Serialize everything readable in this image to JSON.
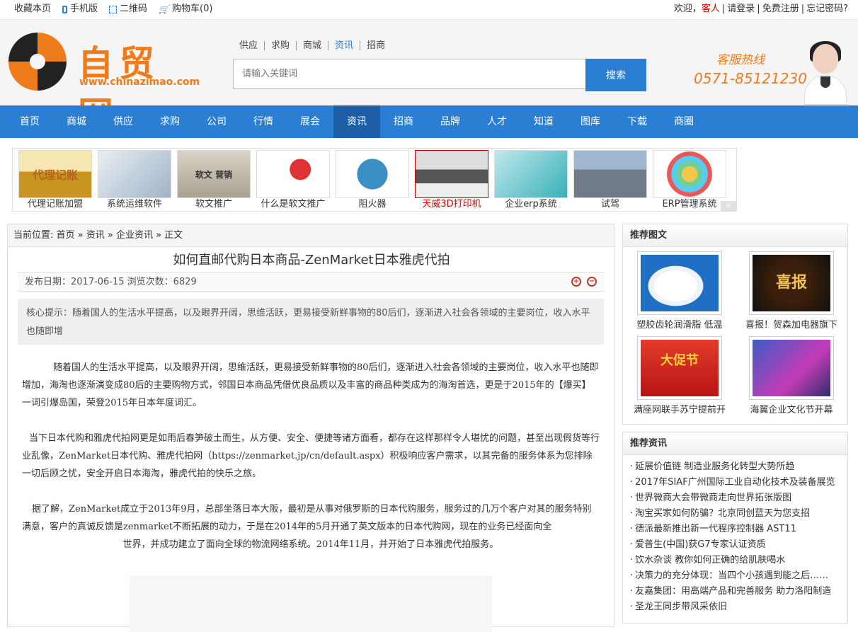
{
  "topbar": {
    "favorite": "收藏本页",
    "mobile": "手机版",
    "qrcode": "二维码",
    "cart": "购物车(0)",
    "welcome": "欢迎，",
    "guest": "客人",
    "login": "请登录",
    "register": "免费注册",
    "forgot": "忘记密码?"
  },
  "header": {
    "logo_name": "自贸网",
    "logo_url": "www.chinazimao.com",
    "search_tabs": [
      "供应",
      "求购",
      "商城",
      "资讯",
      "招商"
    ],
    "active_tab": "资讯",
    "search_placeholder": "请输入关键词",
    "search_button": "搜索",
    "hotline_label": "客服热线",
    "hotline_number": "0571-85121230"
  },
  "nav": {
    "items": [
      "首页",
      "商城",
      "供应",
      "求购",
      "公司",
      "行情",
      "展会",
      "资讯",
      "招商",
      "品牌",
      "人才",
      "知道",
      "图库",
      "下载",
      "商圈"
    ],
    "active": "资讯"
  },
  "ads": [
    {
      "caption": "代理记账加盟",
      "img_text": "代理记账"
    },
    {
      "caption": "系统运维软件",
      "img_text": ""
    },
    {
      "caption": "软文推广",
      "img_text": "软文 营销"
    },
    {
      "caption": "什么是软文推广",
      "img_text": ""
    },
    {
      "caption": "阻火器",
      "img_text": ""
    },
    {
      "caption": "天威3D打印机",
      "img_text": ""
    },
    {
      "caption": "企业erp系统",
      "img_text": ""
    },
    {
      "caption": "试驾",
      "img_text": ""
    },
    {
      "caption": "ERP管理系统",
      "img_text": ""
    }
  ],
  "ad_close": "×",
  "article": {
    "breadcrumb": "当前位置: 首页 » 资讯 » 企业资讯 » 正文",
    "title": "如何直邮代购日本商品-ZenMarket日本雅虎代拍",
    "meta": "发布日期：2017-06-15  浏览次数：6829",
    "zoom_in": "+",
    "zoom_out": "−",
    "summary": "核心提示：随着国人的生活水平提高，以及眼界开阔，思维活跃，更易接受新鲜事物的80后们，逐渐进入社会各领域的主要岗位，收入水平也随即增",
    "p1": "随着国人的生活水平提高，以及眼界开阔，思维活跃，更易接受新鲜事物的80后们，逐渐进入社会各领域的主要岗位，收入水平也随即增加，海淘也逐渐演变成80后的主要购物方式，邻国日本商品凭借优良品质以及丰富的商品种类成为的海淘首选，更是于2015年的【爆买】一词引爆岛国，荣登2015年日本年度词汇。",
    "p2": "当下日本代购和雅虎代拍网更是如雨后春笋破土而生，从方便、安全、便捷等诸方面看，都存在这样那样令人堪忧的问题，甚至出现假货等行业乱像，ZenMarket日本代购、雅虎代拍网（https://zenmarket.jp/cn/default.aspx）积极响应客户需求，以其完备的服务体系为您排除一切后顾之忧，安全开启日本海淘，雅虎代拍的快乐之旅。",
    "p3": "据了解，ZenMarket成立于2013年9月，总部坐落日本大阪，最初是从事对俄罗斯的日本代购服务，服务过的几万个客户对其的服务特别满意，客户的真诚反馈是zenmarket不断拓展的动力，于是在2014年的5月开通了英文版本的日本代购网，现在的业务已经面向全",
    "p3_tail": "世界，并成功建立了面向全球的物流网络系统。2014年11月，并开始了日本雅虎代拍服务。"
  },
  "sidebar": {
    "pics_title": "推荐图文",
    "pics": [
      {
        "caption": "塑胶齿轮润滑脂 低温"
      },
      {
        "caption": "喜报！贺森加电器旗下"
      },
      {
        "caption": "满座网联手苏宁提前开"
      },
      {
        "caption": "海翼企业文化节开幕"
      }
    ],
    "pic2_text": "喜报",
    "pic3_text": "大促节",
    "news_title": "推荐资讯",
    "news": [
      "延展价值链 制造业服务化转型大势所趋",
      "2017年SIAF广州国际工业自动化技术及装备展览",
      "世界微商大会带微商走向世界拓张版图",
      "淘宝买家如何防骗？北京同创蓝天为您支招",
      "德派最新推出新一代程序控制器 AST11",
      "爱普生(中国)获G7专家认证资质",
      "饮水杂谈 教你如何正确的给肌肤喝水",
      "决策力的充分体现：当四个小孩遇到能之后……",
      "友嘉集团：用高端产品和完善服务 助力洛阳制造",
      "圣龙王同步带风采依旧"
    ]
  }
}
